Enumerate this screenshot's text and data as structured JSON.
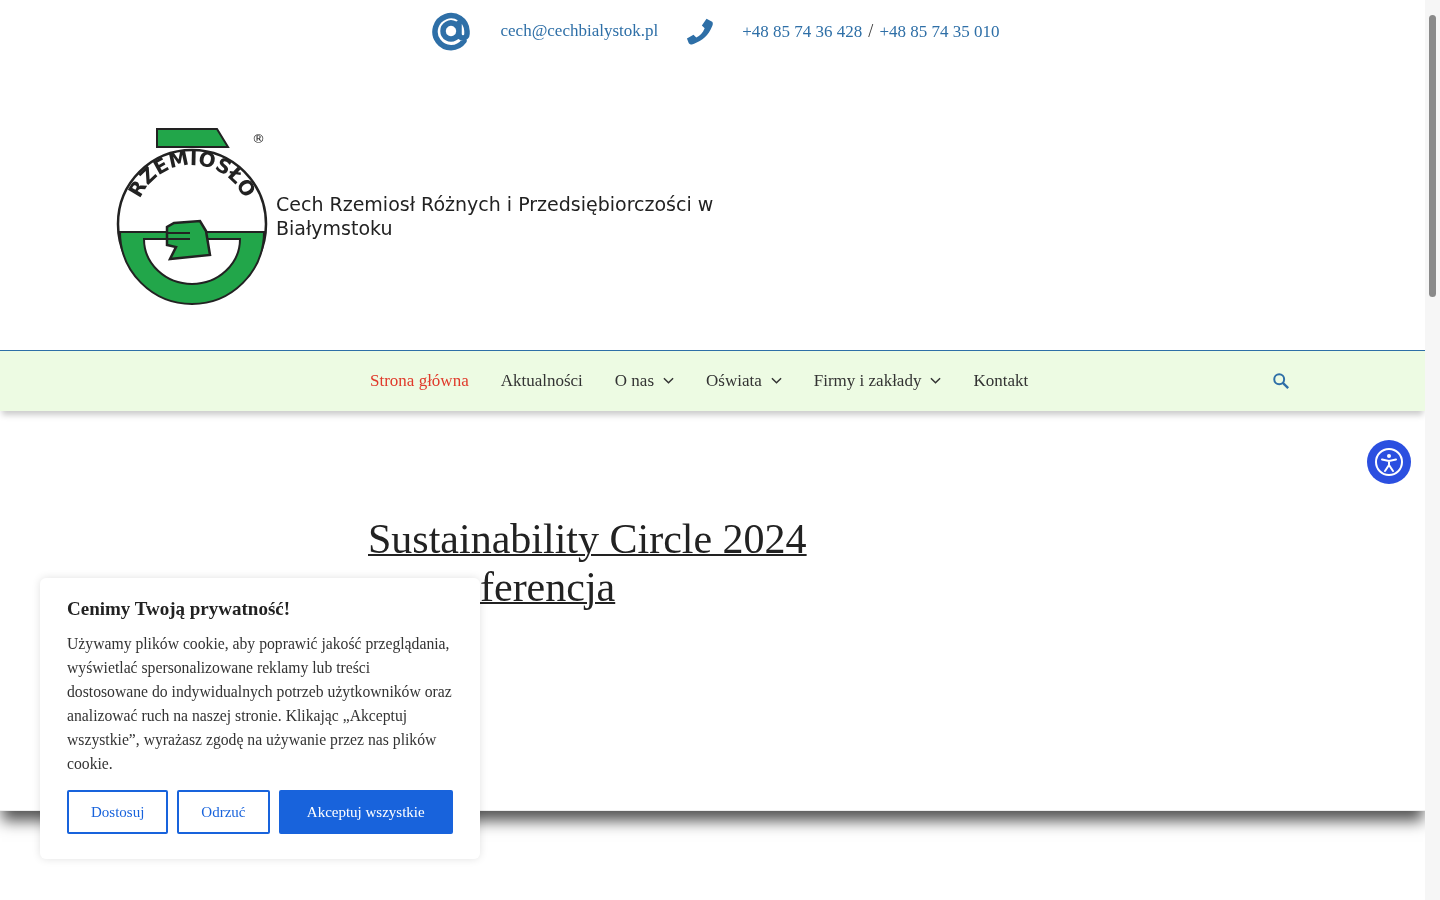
{
  "contact_bar": {
    "email": "cech@cechbialystok.pl",
    "phones": [
      "+48 85 74 36 428",
      "+48 85 74 35 010"
    ],
    "separator": "/"
  },
  "header": {
    "logo_text": "RZEMIOSŁO",
    "logo_mark": "®",
    "site_title": "Cech Rzemiosł Różnych i Przedsiębiorczości w Białymstoku"
  },
  "nav": {
    "items": [
      {
        "label": "Strona główna",
        "selected": true,
        "has_submenu": false
      },
      {
        "label": "Aktualności",
        "selected": false,
        "has_submenu": false
      },
      {
        "label": "O nas",
        "selected": false,
        "has_submenu": true
      },
      {
        "label": "Oświata",
        "selected": false,
        "has_submenu": true
      },
      {
        "label": "Firmy i zakłady",
        "selected": false,
        "has_submenu": true
      },
      {
        "label": "Kontakt",
        "selected": false,
        "has_submenu": false
      }
    ]
  },
  "article": {
    "title_lines": [
      "Sustainability Circle 2024",
      "ferencja"
    ]
  },
  "cookie_banner": {
    "title": "Cenimy Twoją prywatność!",
    "text": "Używamy plików cookie, aby poprawić jakość przeglądania, wyświetlać spersonalizowane reklamy lub treści dostosowane do indywidualnych potrzeb użytkowników oraz analizować ruch na naszej stronie. Klikając „Akceptuj wszystkie”, wyrażasz zgodę na używanie przez nas plików cookie.",
    "buttons": [
      {
        "label": "Dostosuj",
        "kind": "outline"
      },
      {
        "label": "Odrzuć",
        "kind": "outline"
      },
      {
        "label": "Akceptuj wszystkie",
        "kind": "primary"
      }
    ]
  }
}
